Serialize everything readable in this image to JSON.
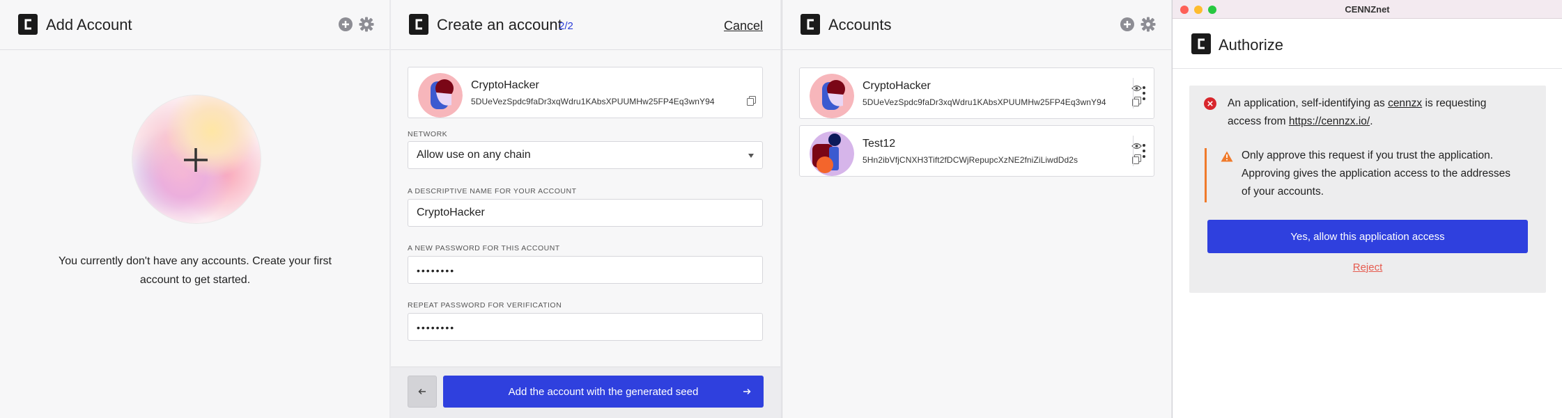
{
  "panel1": {
    "title": "Add Account",
    "empty_line1": "You currently don't have any accounts. Create your first",
    "empty_line2": "account to get started."
  },
  "panel2": {
    "title": "Create an account",
    "step": "2/2",
    "cancel": "Cancel",
    "account": {
      "name": "CryptoHacker",
      "address": "5DUeVezSpdc9faDr3xqWdru1KAbsXPUUMHw25FP4Eq3wnY94"
    },
    "network_label": "NETWORK",
    "network_value": "Allow use on any chain",
    "name_label": "A DESCRIPTIVE NAME FOR YOUR ACCOUNT",
    "name_value": "CryptoHacker",
    "password_label": "A NEW PASSWORD FOR THIS ACCOUNT",
    "password_value": "••••••••",
    "repeat_label": "REPEAT PASSWORD FOR VERIFICATION",
    "repeat_value": "••••••••",
    "submit": "Add the account with the generated seed"
  },
  "panel3": {
    "title": "Accounts",
    "accounts": [
      {
        "name": "CryptoHacker",
        "address": "5DUeVezSpdc9faDr3xqWdru1KAbsXPUUMHw25FP4Eq3wnY94"
      },
      {
        "name": "Test12",
        "address": "5Hn2ibVfjCNXH3Tift2fDCWjRepupcXzNE2fniZiLiwdDd2s"
      }
    ]
  },
  "panel4": {
    "window_title": "CENNZnet",
    "title": "Authorize",
    "info_prefix": "An application, self-identifying as",
    "info_app": "cennzx",
    "info_mid": "is requesting",
    "info_line2_prefix": "access from",
    "info_url": "https://cennzx.io/",
    "info_suffix": ".",
    "warning_line1": "Only approve this request if you trust the application.",
    "warning_line2": "Approving gives the application access to the addresses",
    "warning_line3": "of your accounts.",
    "allow_button": "Yes, allow this application access",
    "reject": "Reject"
  },
  "colors": {
    "primary": "#2f40de",
    "warning": "#f07a2b",
    "error": "#d8262c",
    "reject": "#e65b4f"
  }
}
